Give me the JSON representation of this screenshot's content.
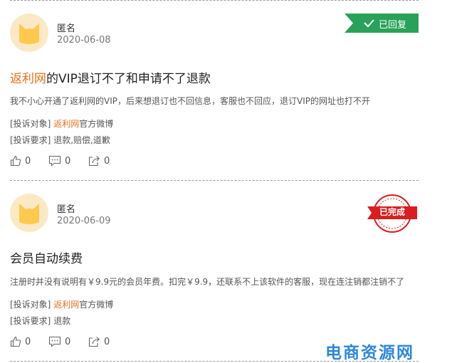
{
  "posts": [
    {
      "author": "匿名",
      "date": "2020-06-08",
      "status": "已回复",
      "title_brand": "返利网",
      "title_rest": "的VIP退订不了和申请不了退款",
      "description": "我不小心开通了返利网的VIP，后来想退订也不回信息，客服也不回应，退订VIP的网址也打不开",
      "target_label": "[投诉对象]",
      "target_brand": "返利网",
      "target_rest": "官方微博",
      "demand_label": "[投诉要求]",
      "demand_value": "退款,赔偿,道歉",
      "likes": "0",
      "comments": "0",
      "shares": "0"
    },
    {
      "author": "匿名",
      "date": "2020-06-09",
      "status": "已完成",
      "title_brand": "",
      "title_rest": "会员自动续费",
      "description": "注册时并没有说明有￥9.9元的会员年费。扣完￥9.9，还联系不上该软件的客服，现在连注销都注销不了",
      "target_label": "[投诉对象]",
      "target_brand": "返利网",
      "target_rest": "官方微博",
      "demand_label": "[投诉要求]",
      "demand_value": "退款",
      "likes": "0",
      "comments": "0",
      "shares": "0"
    }
  ],
  "watermark": "电商资源网",
  "colors": {
    "brand_orange": "#e8701a",
    "replied_green": "#2aa15a",
    "completed_red": "#d81e1e",
    "watermark_blue": "#2e88d8"
  },
  "icons": {
    "avatar": "cat-avatar-icon",
    "like": "thumbs-up-icon",
    "comment": "comment-icon",
    "share": "share-icon",
    "replied": "check-icon",
    "completed": "stamp-seal-icon"
  }
}
